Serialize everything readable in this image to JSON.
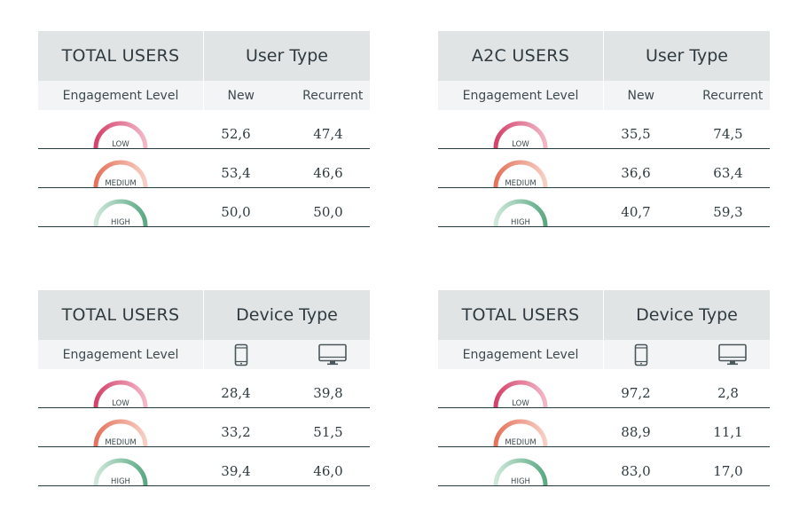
{
  "tables": [
    {
      "title": "TOTAL USERS",
      "group": "User Type",
      "row_header": "Engagement Level",
      "columns": [
        {
          "label": "New",
          "icon": null
        },
        {
          "label": "Recurrent",
          "icon": null
        }
      ],
      "rows": [
        {
          "level": "LOW",
          "values": [
            "52,6",
            "47,4"
          ]
        },
        {
          "level": "MEDIUM",
          "values": [
            "53,4",
            "46,6"
          ]
        },
        {
          "level": "HIGH",
          "values": [
            "50,0",
            "50,0"
          ]
        }
      ]
    },
    {
      "title": "A2C USERS",
      "group": "User Type",
      "row_header": "Engagement Level",
      "columns": [
        {
          "label": "New",
          "icon": null
        },
        {
          "label": "Recurrent",
          "icon": null
        }
      ],
      "rows": [
        {
          "level": "LOW",
          "values": [
            "35,5",
            "74,5"
          ]
        },
        {
          "level": "MEDIUM",
          "values": [
            "36,6",
            "63,4"
          ]
        },
        {
          "level": "HIGH",
          "values": [
            "40,7",
            "59,3"
          ]
        }
      ]
    },
    {
      "title": "TOTAL USERS",
      "group": "Device Type",
      "row_header": "Engagement Level",
      "columns": [
        {
          "label": "",
          "icon": "mobile-phone-icon"
        },
        {
          "label": "",
          "icon": "desktop-monitor-icon"
        }
      ],
      "rows": [
        {
          "level": "LOW",
          "values": [
            "28,4",
            "39,8"
          ]
        },
        {
          "level": "MEDIUM",
          "values": [
            "33,2",
            "51,5"
          ]
        },
        {
          "level": "HIGH",
          "values": [
            "39,4",
            "46,0"
          ]
        }
      ]
    },
    {
      "title": "TOTAL USERS",
      "group": "Device Type",
      "row_header": "Engagement Level",
      "columns": [
        {
          "label": "",
          "icon": "mobile-phone-icon"
        },
        {
          "label": "",
          "icon": "desktop-monitor-icon"
        }
      ],
      "rows": [
        {
          "level": "LOW",
          "values": [
            "97,2",
            "2,8"
          ]
        },
        {
          "level": "MEDIUM",
          "values": [
            "88,9",
            "11,1"
          ]
        },
        {
          "level": "HIGH",
          "values": [
            "83,0",
            "17,0"
          ]
        }
      ]
    }
  ],
  "gauge_colors": {
    "LOW": [
      "#d4426a",
      "#f2b8c8"
    ],
    "MEDIUM": [
      "#e5735c",
      "#f7cfc4"
    ],
    "HIGH": [
      "#cfe8da",
      "#5aa983"
    ]
  }
}
